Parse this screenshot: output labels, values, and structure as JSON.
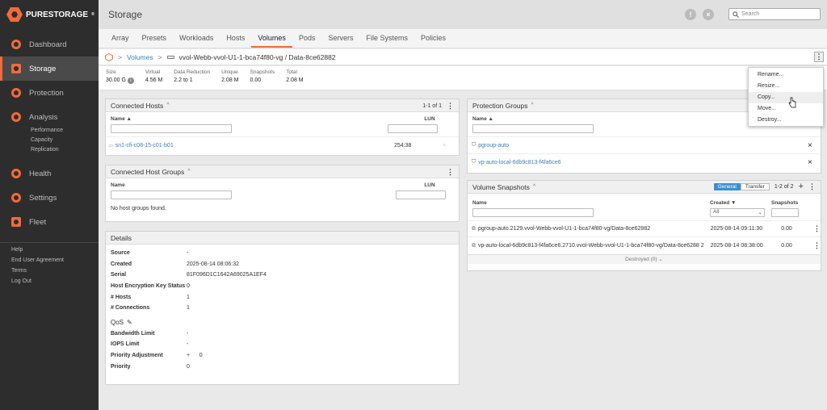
{
  "brand": {
    "name": "PURESTORAGE",
    "tm": "®"
  },
  "sidebar": {
    "items": [
      {
        "label": "Dashboard"
      },
      {
        "label": "Storage"
      },
      {
        "label": "Protection"
      },
      {
        "label": "Analysis",
        "subs": [
          "Performance",
          "Capacity",
          "Replication"
        ]
      },
      {
        "label": "Health"
      },
      {
        "label": "Settings"
      },
      {
        "label": "Fleet"
      }
    ],
    "footer": [
      "Help",
      "End User Agreement",
      "Terms",
      "Log Out"
    ]
  },
  "header": {
    "title": "Storage",
    "search_placeholder": "Search"
  },
  "tabs": [
    "Array",
    "Presets",
    "Workloads",
    "Hosts",
    "Volumes",
    "Pods",
    "Servers",
    "File Systems",
    "Policies"
  ],
  "active_tab": "Volumes",
  "breadcrumb": {
    "link": "Volumes",
    "current": "vvol-Webb-vvol-U1-1-bca74f80-vg / Data-8ce62882"
  },
  "stats": [
    {
      "label": "Size",
      "value": "30.00 G"
    },
    {
      "label": "Virtual",
      "value": "4.56 M"
    },
    {
      "label": "Data Reduction",
      "value": "2.2 to 1"
    },
    {
      "label": "Unique",
      "value": "2.08 M"
    },
    {
      "label": "Snapshots",
      "value": "0.00"
    },
    {
      "label": "Total",
      "value": "2.08 M"
    }
  ],
  "connected_hosts": {
    "title": "Connected Hosts",
    "paging": "1-1 of 1",
    "col_name": "Name ▲",
    "col_lun": "LUN",
    "rows": [
      {
        "name": "sn1-cfi-c08-15-c01-b01",
        "lun": "254:38"
      }
    ]
  },
  "connected_host_groups": {
    "title": "Connected Host Groups",
    "col_name": "Name",
    "col_lun": "LUN",
    "empty": "No host groups found."
  },
  "details": {
    "title": "Details",
    "rows": [
      {
        "label": "Source",
        "value": "-"
      },
      {
        "label": "Created",
        "value": "2025-08-14 08:06:32"
      },
      {
        "label": "Serial",
        "value": "81F096D1C1642A69025A1EF4"
      },
      {
        "label": "Host Encryption Key Status",
        "value": "0"
      },
      {
        "label": "# Hosts",
        "value": "1"
      },
      {
        "label": "# Connections",
        "value": "1"
      }
    ],
    "qos_title": "QoS",
    "qos": [
      {
        "label": "Bandwidth Limit",
        "value": "-"
      },
      {
        "label": "IOPS Limit",
        "value": "-"
      },
      {
        "label": "Priority Adjustment",
        "value": "+      0"
      },
      {
        "label": "Priority",
        "value": "0"
      }
    ]
  },
  "protection_groups": {
    "title": "Protection Groups",
    "col_name": "Name ▲",
    "rows": [
      "pgroup-auto",
      "vp-auto-local-6db9c813-f4fa6ce6"
    ]
  },
  "volume_snapshots": {
    "title": "Volume Snapshots",
    "btn_general": "General",
    "btn_transfer": "Transfer",
    "paging": "1-2 of 2",
    "col_name": "Name",
    "col_created": "Created ▼",
    "col_snapshots": "Snapshots",
    "created_filter": "All",
    "rows": [
      {
        "name": "pgroup-auto.2129.vvol-Webb-vvol-U1-1-bca74f80-vg/Data-8ce62882",
        "created": "2025-08-14 09:11:30",
        "snap": "0.00"
      },
      {
        "name": "vp-auto-local-6db9c813-f4fa6ce6.2710.vvol-Webb-vvol-U1-1-bca74f80-vg/Data-8ce6288 2",
        "created": "2025-08-14 08:38:00",
        "snap": "0.00"
      }
    ],
    "destroyed": "Destroyed (0) ⌄"
  },
  "menu": [
    "Rename...",
    "Resize...",
    "Copy...",
    "Move...",
    "Destroy..."
  ],
  "colors": {
    "accent": "#f26b3a",
    "link": "#3a80c0",
    "sidebar": "#2d2d2d"
  }
}
